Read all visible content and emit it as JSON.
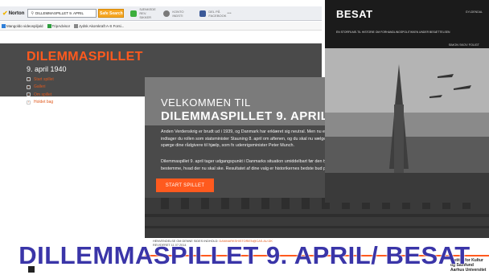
{
  "toolbar": {
    "brand": "Norton",
    "search_value": "DILLEMMASPILLET 9. APRIL",
    "search_button": "Safe Search",
    "group1_label": "SÆNKEDE REV. SIKKER",
    "group2_label": "KONTO INDSTI",
    "group3_label": "DEL PÅ FACEBOOK",
    "more": "•••"
  },
  "bookmarks": [
    {
      "label": "Mangoldo videospiljald"
    },
    {
      "label": "TripAdvisor"
    },
    {
      "label": "Jydsk Akomkraft A-S Forsi..."
    }
  ],
  "site": {
    "title": "DILEMMASPILLET",
    "subtitle": "9. april 1940",
    "nav": [
      {
        "label": "Start spillet"
      },
      {
        "label": "Galleri"
      },
      {
        "label": "Om spillet"
      },
      {
        "label": "Holdet bag"
      }
    ],
    "welcome_line1": "VELKOMMEN TIL",
    "welcome_line2": "DILEMMASPILLET 9. APRIL",
    "paragraph1": [
      "Anden Verdenskrig er brudt ud i 1939, og Danmark har erklæret sig neutral. Men nu er der frygt for, at Tyskland måske vil angribe.",
      "indtager du rollen som statsminister Stauning 8. april om aftenen, og du skal nu vælge, hvad Danmark skal stille op. Undervejs kan du",
      "spørge dine rådgivere til hjælp, som fx udenrigsminister Peter Munch."
    ],
    "paragraph2": [
      "Dilemmaspillet 9. april tager udgangspunkt i Danmarks situation umiddelbart før den tyske besættelse 9. april 1940 og lader dig",
      "bestemme, hvad der nu skal ske. Resultatet af dine valg er historikernes bedste bud på, hvad der ville være sket - hvis nu ..."
    ],
    "start_button": "START SPILLET",
    "contact_prefix": "HENVENDELSE OM DENNE SIDES INDHOLD:",
    "contact_link": "DANMARKSHISTORIEN@CAS.AU.DK",
    "revised": "REVIDERET 11.07.2014",
    "institute_line1": "Institut for Kultur og Samfund",
    "institute_line2": "Aarhus Universitet"
  },
  "cover": {
    "title": "BESAT",
    "publisher": "GYLDENDAL",
    "subtitle": "EN STORFILME-TIL HISTORIE OM FORHANDLINGSPOLITIKKEN UNDER BESÆTTELSEN",
    "author": "SIMON SKOV FOUGT"
  },
  "caption": "DILLEMMASPILLET 9. APRIL/ BESAT",
  "colors": {
    "accent": "#ff5a1e",
    "header": "#4a4a4a",
    "caption": "#3a35a8"
  }
}
